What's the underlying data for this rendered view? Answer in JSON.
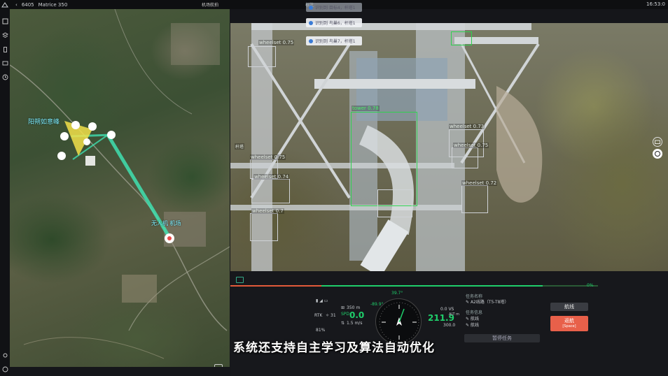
{
  "topbar": {
    "device_id": "6405",
    "model": "Matrice 350",
    "center_title": "标注",
    "map_label": "机场航拍",
    "time": "16:53:0"
  },
  "toasts": [
    {
      "text": "识别到 目标4，杆塔1"
    },
    {
      "text": "识别到 鸟巢6，杆塔1"
    },
    {
      "text": "识别到 鸟巢7，杆塔1"
    }
  ],
  "map": {
    "label_a": "阳朔如意峰",
    "label_b": "无人机 机场"
  },
  "detections": [
    {
      "label": "tower 0.78",
      "box": true
    },
    {
      "label": "wheelset 0.75"
    },
    {
      "label": "wheelset 0.73"
    },
    {
      "label": "wheelset 0.75"
    },
    {
      "label": "wheelset 0.75"
    },
    {
      "label": "wheelset 0.74"
    },
    {
      "label": "wheelset 0.72"
    },
    {
      "label": "杆塔"
    },
    {
      "label": "wheelset 0.7"
    },
    {
      "label": "wheelset 0.73"
    }
  ],
  "telemetry": {
    "rtk_label": "RTK",
    "rtk_count": "31",
    "battery": "81%",
    "alt_value": "350 m",
    "speed_h": "0.0",
    "speed_v": "1.5 m/s",
    "heading": "39.7°",
    "pitch": "-89.9°",
    "vs": "0.0 VS",
    "alt_big": "211.9",
    "alt_unit": "ALT m",
    "dist": "300.0"
  },
  "mission": {
    "title": "任务名称",
    "name": "A2线路（T5-T8塔）",
    "info_title": "任务信息",
    "item1": "航线",
    "item2": "航线",
    "progress_pct": "0%",
    "progress": 0.85
  },
  "buttons": {
    "route": "航线",
    "return_label": "返航",
    "return_hint": "[Space]",
    "pause": "暂停任务"
  },
  "subtitle": "系统还支持自主学习及算法自动优化",
  "colors": {
    "accent_green": "#1fcf6b",
    "detect_green": "#2fd14f",
    "return_red": "#e8604a",
    "route_cyan": "#3fe0b0"
  }
}
